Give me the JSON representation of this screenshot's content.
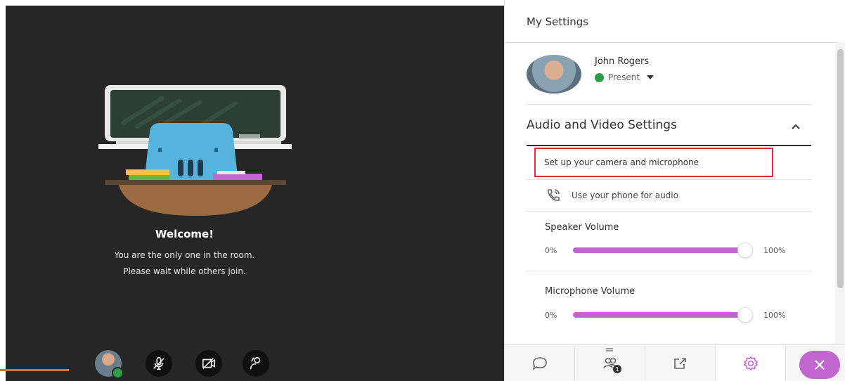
{
  "stage": {
    "welcome_title": "Welcome!",
    "welcome_line1": "You are the only one in the room.",
    "welcome_line2": "Please wait while others join.",
    "controls": [
      {
        "icon": "avatar"
      },
      {
        "icon": "microphone-muted-icon"
      },
      {
        "icon": "camera-off-icon"
      },
      {
        "icon": "raise-hand-icon"
      }
    ]
  },
  "panel": {
    "title": "My Settings",
    "user": {
      "name": "John Rogers",
      "status": "Present"
    },
    "av_section": {
      "title": "Audio and Video Settings",
      "setup_link": "Set up your camera and microphone",
      "phone_link": "Use your phone for audio"
    },
    "speaker": {
      "label": "Speaker Volume",
      "min": "0%",
      "max": "100%",
      "level": 0.95
    },
    "microphone": {
      "label": "Microphone Volume",
      "min": "0%",
      "max": "100%",
      "level": 0.95
    },
    "toolbar": {
      "items": [
        "chat-icon",
        "attendees-icon",
        "share-content-icon",
        "settings-icon",
        "close-icon"
      ],
      "attendee_badge": "1"
    }
  },
  "colors": {
    "accent": "#c266cf",
    "present": "#2e9d45",
    "highlight_border": "#d9303c",
    "stage_bg": "#262626"
  }
}
